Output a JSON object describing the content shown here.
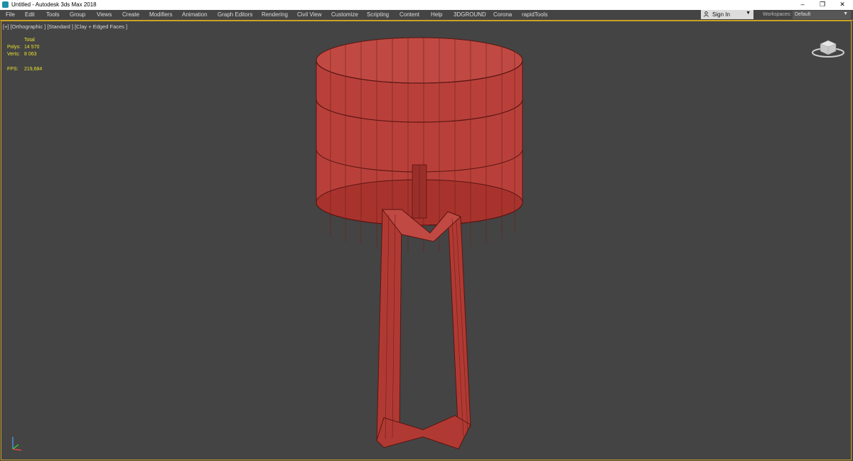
{
  "window": {
    "title": "Untitled - Autodesk 3ds Max 2018",
    "controls": {
      "minimize": "–",
      "restore": "❐",
      "close": "✕"
    }
  },
  "menu": {
    "items": [
      "File",
      "Edit",
      "Tools",
      "Group",
      "Views",
      "Create",
      "Modifiers",
      "Animation",
      "Graph Editors",
      "Rendering",
      "Civil View",
      "Customize",
      "Scripting",
      "Content",
      "Help",
      "3DGROUND",
      "Corona",
      "rapidTools"
    ]
  },
  "account": {
    "sign_in_label": "Sign In",
    "icon": "user-icon"
  },
  "workspaces": {
    "label": "Workspaces:",
    "value": "Default"
  },
  "viewport": {
    "label": "[+] [Orthographic ] [Standard ] [Clay + Edged Faces ]",
    "stats": {
      "total_label": "Total",
      "polys_label": "Polys:",
      "polys_value": "14 570",
      "verts_label": "Verts:",
      "verts_value": "8 063",
      "fps_label": "FPS:",
      "fps_value": "219,684"
    }
  },
  "colors": {
    "viewport_bg": "#444444",
    "active_border": "#c9a227",
    "stats_text": "#e8e030",
    "model_face": "#b9403a",
    "model_edge": "#5a1512"
  }
}
